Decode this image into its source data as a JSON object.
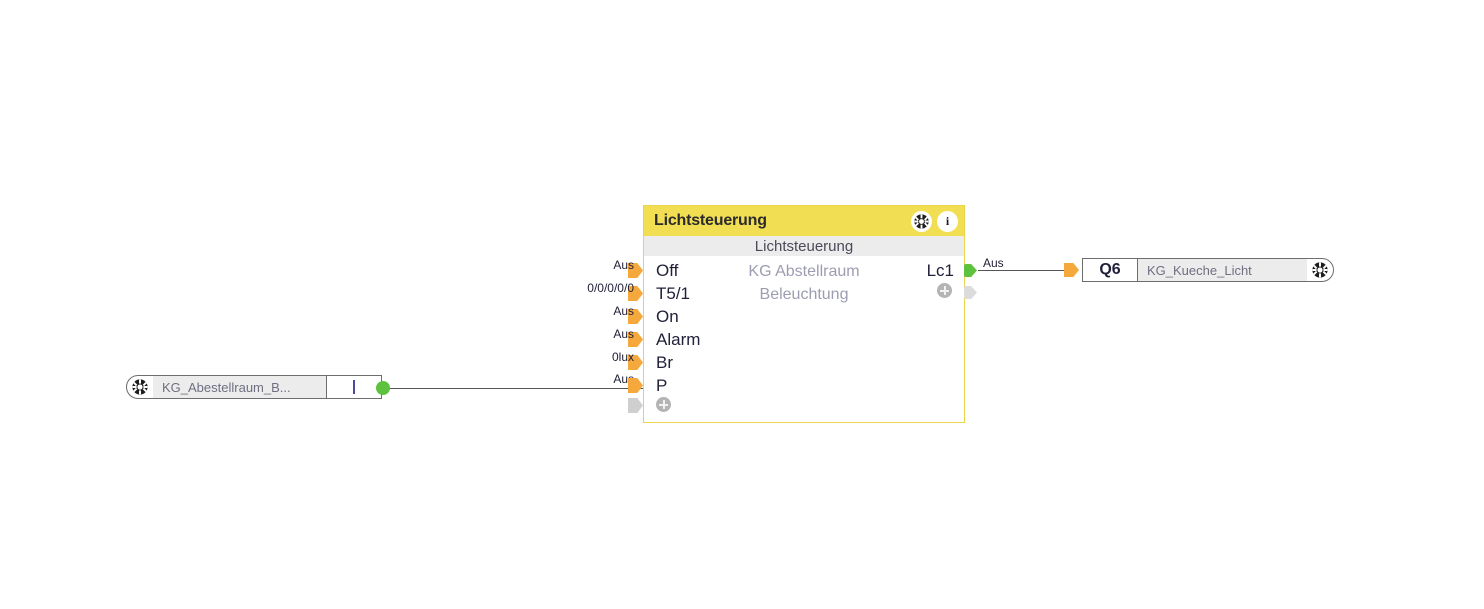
{
  "colors": {
    "block_header": "#f2de52",
    "block_border": "#e8d44d",
    "subbar": "#ececec",
    "input_arrow": "#f5a93c",
    "output_dot": "#5ec23f",
    "disabled_connector": "#cfcfcf",
    "wire": "#545454",
    "description_text": "#9d9db2",
    "node_name_text": "#6f6f82"
  },
  "block": {
    "title": "Lichtsteuerung",
    "subtitle": "Lichtsteuerung",
    "description_line1": "KG Abstellraum",
    "description_line2": "Beleuchtung",
    "header_icons": [
      {
        "name": "gear-icon",
        "glyph": "gear"
      },
      {
        "name": "info-icon",
        "glyph": "i",
        "label": "i"
      }
    ],
    "inputs": [
      {
        "name": "Off",
        "value": "Aus",
        "connector": "arrow"
      },
      {
        "name": "T5/1",
        "value": "0/0/0/0/0",
        "connector": "arrow"
      },
      {
        "name": "On",
        "value": "Aus",
        "connector": "arrow"
      },
      {
        "name": "Alarm",
        "value": "Aus",
        "connector": "arrow"
      },
      {
        "name": "Br",
        "value": "0lux",
        "connector": "arrow"
      },
      {
        "name": "P",
        "value": "Aus",
        "connector": "arrow"
      }
    ],
    "add_input_label": "+",
    "outputs": [
      {
        "name": "Lc1",
        "value": "Aus",
        "connector": "dot"
      }
    ],
    "add_output_label": "+"
  },
  "input_node": {
    "gear_icon": "gear-icon",
    "name": "KG_Abestellraum_B...",
    "terminal": "I"
  },
  "output_node": {
    "terminal": "Q6",
    "name": "KG_Kueche_Licht",
    "gear_icon": "gear-icon"
  },
  "wires": [
    {
      "from": "input-node-output",
      "to": "block-input-P",
      "value": "Aus"
    },
    {
      "from": "block-output-Lc1",
      "to": "output-node-Q6",
      "value": "Aus"
    }
  ]
}
